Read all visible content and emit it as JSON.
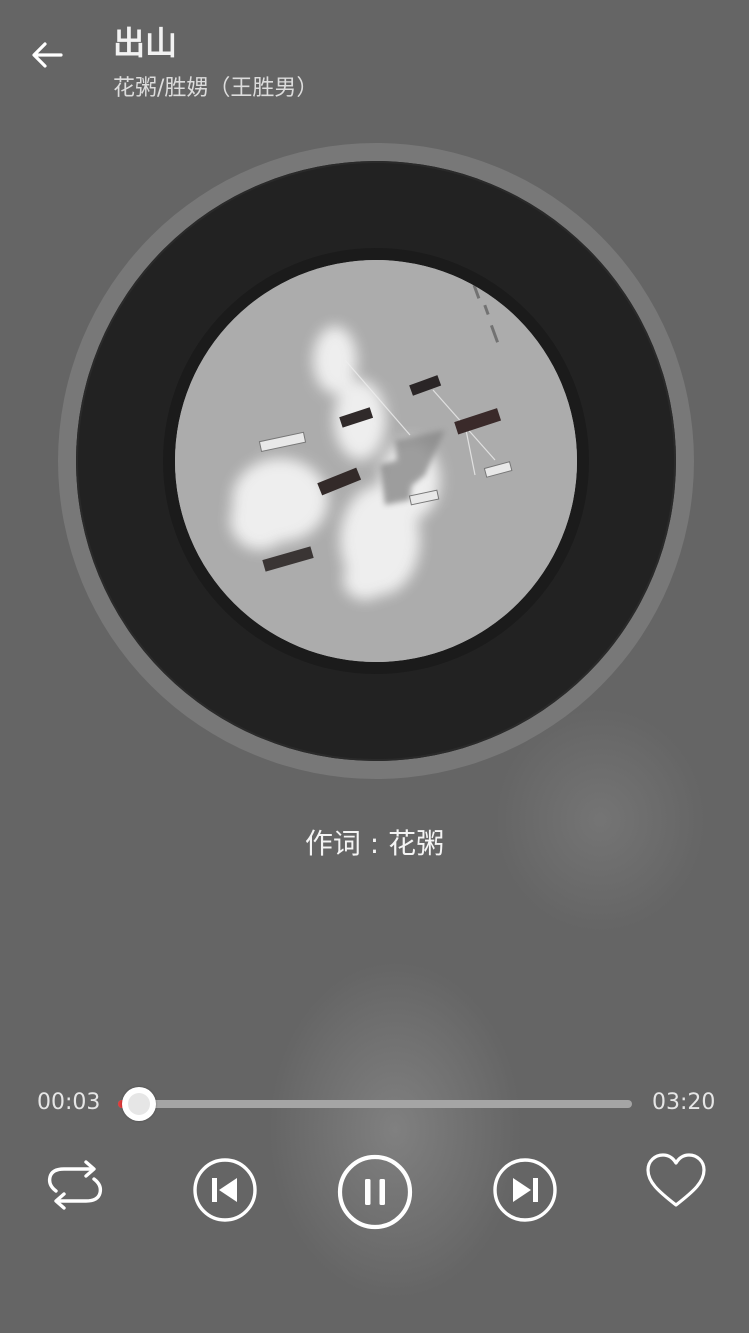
{
  "song": {
    "title": "出山",
    "artist": "花粥/胜娚（王胜男）"
  },
  "lyric": {
    "current_line": "作词 : 花粥"
  },
  "playback": {
    "current_time": "00:03",
    "total_time": "03:20",
    "progress": 0.04,
    "state": "playing"
  },
  "controls": {
    "repeat": "repeat-icon",
    "previous": "skip-previous-icon",
    "play_pause": "pause-icon",
    "next": "skip-next-icon",
    "favorite": "heart-outline-icon"
  },
  "colors": {
    "background": "#656565",
    "progress_fill": "#e03a3a",
    "progress_track": "#a5a5a5",
    "icon": "#ffffff"
  }
}
